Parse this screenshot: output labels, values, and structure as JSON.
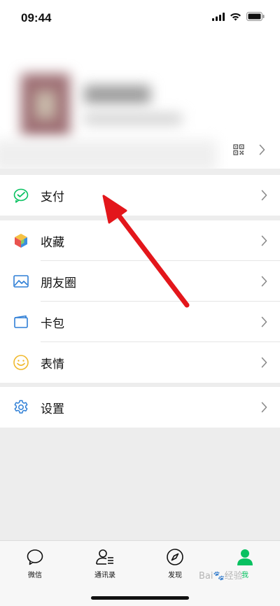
{
  "status_bar": {
    "time": "09:44"
  },
  "menu": {
    "pay": {
      "label": "支付"
    },
    "favorites": {
      "label": "收藏"
    },
    "moments": {
      "label": "朋友圈"
    },
    "cards": {
      "label": "卡包"
    },
    "stickers": {
      "label": "表情"
    },
    "settings": {
      "label": "设置"
    }
  },
  "tabbar": {
    "chats": {
      "label": "微信"
    },
    "contacts": {
      "label": "通讯录"
    },
    "discover": {
      "label": "发现"
    },
    "me": {
      "label": "我"
    }
  },
  "watermark": {
    "text": "Bai🐾经验"
  },
  "colors": {
    "accent": "#07c160",
    "arrow": "#e3161b",
    "background": "#ededed"
  }
}
